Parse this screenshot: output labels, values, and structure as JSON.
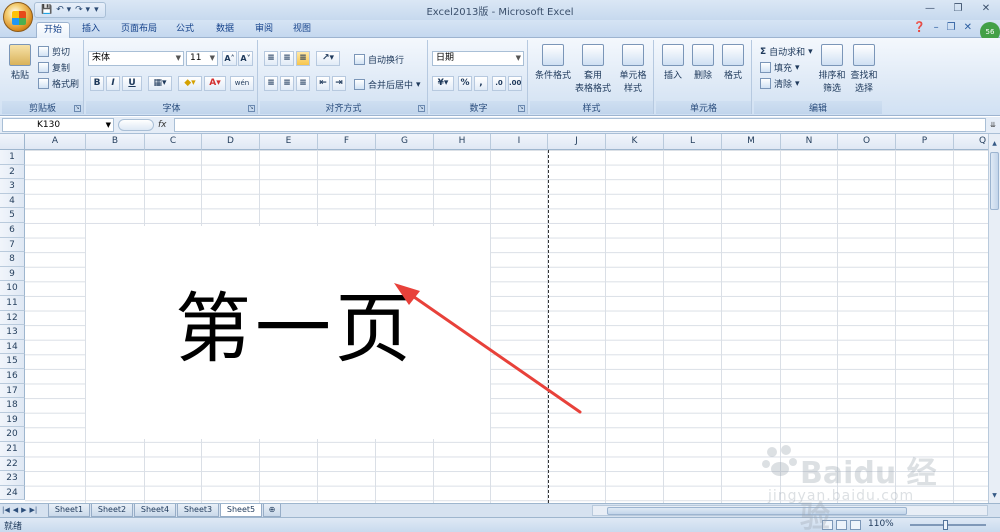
{
  "window": {
    "title": "Excel2013版 - Microsoft Excel",
    "controls": [
      "—",
      "❐",
      "✕"
    ]
  },
  "qat": {
    "items": [
      "💾",
      "↶ ▾",
      "↷ ▾",
      "▾"
    ]
  },
  "tabs": [
    {
      "label": "开始",
      "active": true
    },
    {
      "label": "插入"
    },
    {
      "label": "页面布局"
    },
    {
      "label": "公式"
    },
    {
      "label": "数据"
    },
    {
      "label": "审阅"
    },
    {
      "label": "视图"
    }
  ],
  "avatar": {
    "text": "56"
  },
  "ribbon": {
    "clipboard": {
      "label": "剪贴板",
      "paste": "粘贴",
      "cut": "剪切",
      "copy": "复制",
      "format_painter": "格式刷"
    },
    "font": {
      "label": "字体",
      "font_name": "宋体",
      "font_size": "11",
      "bold": "B",
      "italic": "I",
      "underline": "U",
      "grow": "A˄",
      "shrink": "A˅",
      "wen": "wén"
    },
    "alignment": {
      "label": "对齐方式",
      "wrap": "自动换行",
      "merge": "合并后居中"
    },
    "number": {
      "label": "数字",
      "format": "日期",
      "percent": "%",
      "comma": ","
    },
    "styles": {
      "label": "样式",
      "conditional": "条件格式",
      "table_line1": "套用",
      "table_line2": "表格格式",
      "cell_styles_line1": "单元格",
      "cell_styles_line2": "样式"
    },
    "cells": {
      "label": "单元格",
      "insert": "插入",
      "delete": "删除",
      "format": "格式"
    },
    "editing": {
      "label": "编辑",
      "autosum": "自动求和",
      "fill": "填充",
      "clear": "清除",
      "sort_line1": "排序和",
      "sort_line2": "筛选",
      "find_line1": "查找和",
      "find_line2": "选择"
    }
  },
  "formula_bar": {
    "name_box": "K130",
    "fx": "fx",
    "content": ""
  },
  "grid": {
    "columns": [
      "A",
      "B",
      "C",
      "D",
      "E",
      "F",
      "G",
      "H",
      "I",
      "J",
      "K",
      "L",
      "M",
      "N",
      "O",
      "P",
      "Q"
    ],
    "rows": [
      "1",
      "2",
      "3",
      "4",
      "5",
      "6",
      "7",
      "8",
      "9",
      "10",
      "11",
      "12",
      "13",
      "14",
      "15",
      "16",
      "17",
      "18",
      "19",
      "20",
      "21",
      "22",
      "23",
      "24"
    ],
    "cell_text": "第一页"
  },
  "sheets": [
    {
      "label": "Sheet1"
    },
    {
      "label": "Sheet2"
    },
    {
      "label": "Sheet4"
    },
    {
      "label": "Sheet3"
    },
    {
      "label": "Sheet5",
      "active": true
    }
  ],
  "status": {
    "ready": "就绪",
    "zoom": "110%"
  },
  "watermark": {
    "brand": "Baidu 经验",
    "url": "jingyan.baidu.com"
  },
  "colors": {
    "accent": "#15428b",
    "arrow": "#e8413a"
  }
}
